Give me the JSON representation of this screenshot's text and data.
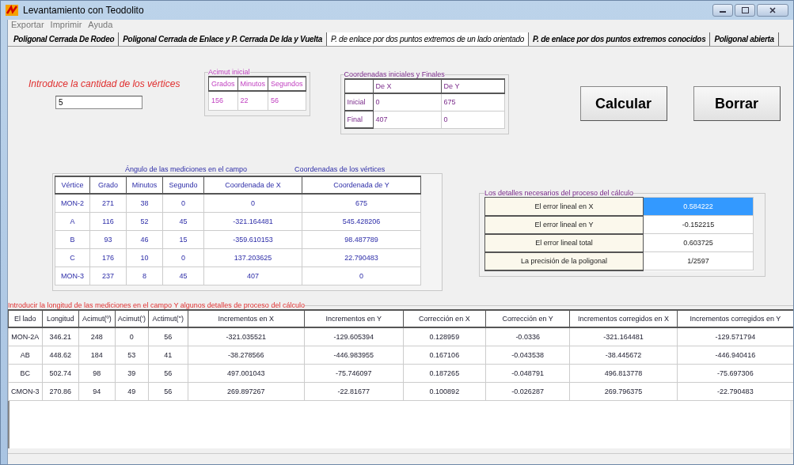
{
  "window": {
    "title": "Levantamiento con Teodolito"
  },
  "menu": [
    "Exportar",
    "Imprimir",
    "Ayuda"
  ],
  "tabs": [
    {
      "label": "Poligonal Cerrada De Rodeo",
      "selected": false
    },
    {
      "label": "Poligonal Cerrada de Enlace y P. Cerrada De Ida y Vuelta",
      "selected": false
    },
    {
      "label": "P. de enlace por dos puntos extremos de un lado orientado",
      "selected": true
    },
    {
      "label": "P. de enlace por dos puntos extremos conocidos",
      "selected": false
    },
    {
      "label": "Poligonal abierta",
      "selected": false
    }
  ],
  "vertex_count": {
    "label": "Introduce la cantidad de los vértices",
    "value": "5"
  },
  "initial_azimuth": {
    "title": "Acimut inicial",
    "columns": [
      "Grados",
      "Minutos",
      "Segundos"
    ],
    "values": [
      "156",
      "22",
      "56"
    ]
  },
  "coordinates": {
    "title": "Coordenadas iniciales y Finales",
    "columns": [
      "De X",
      "De Y"
    ],
    "rows": [
      {
        "label": "Inicial",
        "values": [
          "0",
          "675"
        ]
      },
      {
        "label": "Final",
        "values": [
          "407",
          "0"
        ]
      }
    ]
  },
  "buttons": [
    "Calcular",
    "Borrar"
  ],
  "vertices": {
    "title_left": "Ángulo de las mediciones en el campo",
    "title_right": "Coordenadas de los vértices",
    "columns": [
      "Vértice",
      "Grado",
      "Minutos",
      "Segundo",
      "Coordenada de X",
      "Coordenada de Y"
    ],
    "rows": [
      [
        "MON-2",
        "271",
        "38",
        "0",
        "0",
        "675"
      ],
      [
        "A",
        "116",
        "52",
        "45",
        "-321.164481",
        "545.428206"
      ],
      [
        "B",
        "93",
        "46",
        "15",
        "-359.610153",
        "98.487789"
      ],
      [
        "C",
        "176",
        "10",
        "0",
        "137.203625",
        "22.790483"
      ],
      [
        "MON-3",
        "237",
        "8",
        "45",
        "407",
        "0"
      ]
    ]
  },
  "details": {
    "title": "Los detalles necesarios del proceso del cálculo",
    "rows": [
      {
        "label": "El error lineal en X",
        "value": "0.584222",
        "selected": true
      },
      {
        "label": "El error lineal en Y",
        "value": "-0.152215",
        "selected": false
      },
      {
        "label": "El error lineal total",
        "value": "0.603725",
        "selected": false
      },
      {
        "label": "La precisión de la poligonal",
        "value": "1/2597",
        "selected": false
      }
    ]
  },
  "sides": {
    "title": "Introducir la longitud de las mediciones en el campo  Y algunos detalles de proceso del cálculo",
    "columns": [
      "El lado",
      "Longitud",
      "Acimut(º)",
      "Acimut(')",
      "Actimut('')",
      "Incrementos en X",
      "Incrementos en Y",
      "Corrección en X",
      "Corrección en Y",
      "Incrementos corregidos en X",
      "Incrementos corregidos en Y"
    ],
    "rows": [
      [
        "MON-2A",
        "346.21",
        "248",
        "0",
        "56",
        "-321.035521",
        "-129.605394",
        "0.128959",
        "-0.0336",
        "-321.164481",
        "-129.571794"
      ],
      [
        "AB",
        "448.62",
        "184",
        "53",
        "41",
        "-38.278566",
        "-446.983955",
        "0.167106",
        "-0.043538",
        "-38.445672",
        "-446.940416"
      ],
      [
        "BC",
        "502.74",
        "98",
        "39",
        "56",
        "497.001043",
        "-75.746097",
        "0.187265",
        "-0.048791",
        "496.813778",
        "-75.697306"
      ],
      [
        "CMON-3",
        "270.86",
        "94",
        "49",
        "56",
        "269.897267",
        "-22.81677",
        "0.100892",
        "-0.026287",
        "269.796375",
        "-22.790483"
      ]
    ]
  }
}
